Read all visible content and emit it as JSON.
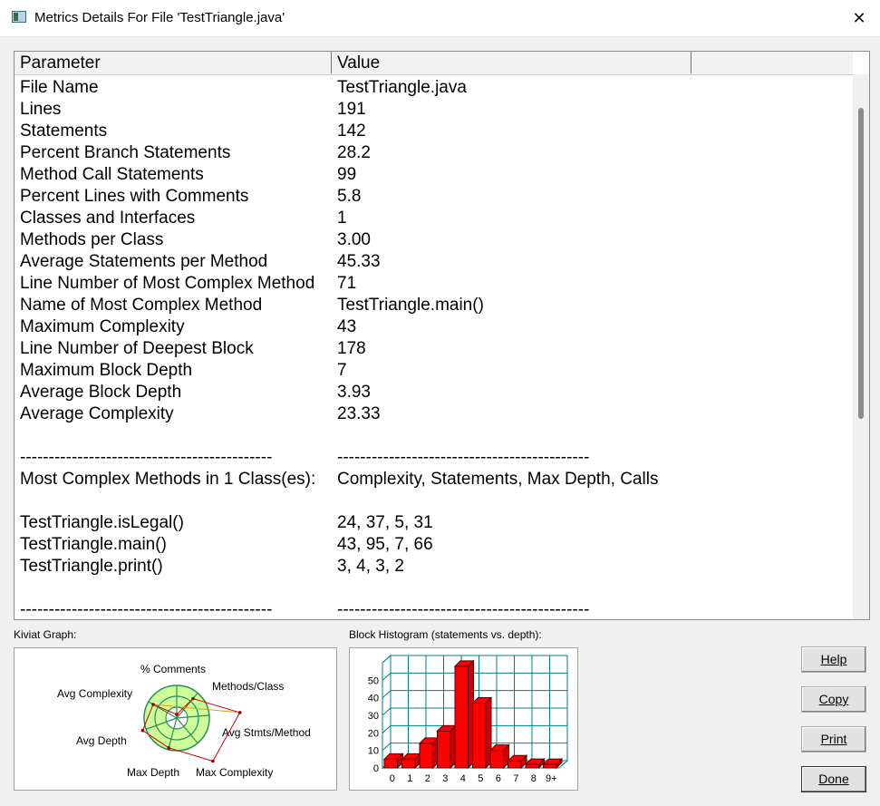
{
  "window": {
    "title": "Metrics Details For File 'TestTriangle.java'"
  },
  "table": {
    "headers": [
      "Parameter",
      "Value"
    ],
    "rows": [
      [
        "File Name",
        "TestTriangle.java"
      ],
      [
        "Lines",
        "191"
      ],
      [
        "Statements",
        "142"
      ],
      [
        "Percent Branch Statements",
        "28.2"
      ],
      [
        "Method Call Statements",
        "99"
      ],
      [
        "Percent Lines with Comments",
        "5.8"
      ],
      [
        "Classes and Interfaces",
        "1"
      ],
      [
        "Methods per Class",
        "3.00"
      ],
      [
        "Average Statements per Method",
        "45.33"
      ],
      [
        "Line Number of Most Complex Method",
        "71"
      ],
      [
        "Name of Most Complex Method",
        "TestTriangle.main()"
      ],
      [
        "Maximum Complexity",
        "43"
      ],
      [
        "Line Number of Deepest Block",
        "178"
      ],
      [
        "Maximum Block Depth",
        "7"
      ],
      [
        "Average Block Depth",
        "3.93"
      ],
      [
        "Average Complexity",
        "23.33"
      ],
      [
        "",
        ""
      ],
      [
        "--------------------------------------------",
        "--------------------------------------------"
      ],
      [
        "Most Complex Methods in 1 Class(es):",
        "Complexity, Statements, Max Depth, Calls"
      ],
      [
        "",
        ""
      ],
      [
        "TestTriangle.isLegal()",
        "24, 37, 5, 31"
      ],
      [
        "TestTriangle.main()",
        "43, 95, 7, 66"
      ],
      [
        "TestTriangle.print()",
        "3, 4, 3, 2"
      ],
      [
        "",
        ""
      ],
      [
        "--------------------------------------------",
        "--------------------------------------------"
      ]
    ]
  },
  "kiviat": {
    "label": "Kiviat Graph:",
    "axes": [
      "% Comments",
      "Methods/Class",
      "Avg Stmts/Method",
      "Max Complexity",
      "Max Depth",
      "Avg Depth",
      "Avg Complexity"
    ]
  },
  "histogram": {
    "label": "Block Histogram (statements vs. depth):",
    "y_ticks": [
      "50",
      "40",
      "30",
      "20",
      "10",
      "0"
    ],
    "x_ticks": [
      "0",
      "1",
      "2",
      "3",
      "4",
      "5",
      "6",
      "7",
      "8",
      "9+"
    ]
  },
  "chart_data": {
    "type": "bar",
    "title": "Block Histogram (statements vs. depth):",
    "categories": [
      "0",
      "1",
      "2",
      "3",
      "4",
      "5",
      "6",
      "7",
      "8",
      "9+"
    ],
    "values": [
      5,
      5,
      14,
      21,
      58,
      37,
      10,
      4,
      2,
      2
    ],
    "ylim": [
      0,
      60
    ],
    "color": "#ff0000"
  },
  "buttons": {
    "help": "Help",
    "copy": "Copy",
    "print": "Print",
    "done": "Done"
  },
  "colors": {
    "bar": "#ff0000",
    "grid": "#008080",
    "kiviat_fill": "#ccff99",
    "kiviat_ring": "#2e8b57"
  }
}
